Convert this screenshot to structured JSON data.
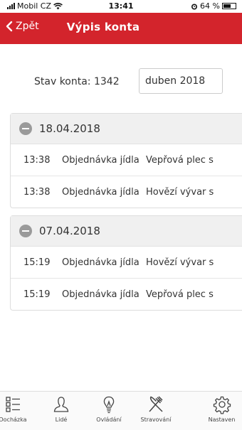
{
  "status_bar": {
    "carrier": "Mobil CZ",
    "time": "13:41",
    "battery": "64 %",
    "battery_level": 0.64
  },
  "header": {
    "back_label": "Zpět",
    "title": "Výpis konta"
  },
  "summary": {
    "balance": "Stav konta: 1342",
    "month": "duben 2018"
  },
  "groups": [
    {
      "date": "18.04.2018",
      "rows": [
        {
          "time": "13:38",
          "type": "Objednávka jídla",
          "meal": "Vepřová plec s"
        },
        {
          "time": "13:38",
          "type": "Objednávka jídla",
          "meal": "Hovězí vývar s"
        }
      ]
    },
    {
      "date": "07.04.2018",
      "rows": [
        {
          "time": "15:19",
          "type": "Objednávka jídla",
          "meal": "Hovězí vývar s"
        },
        {
          "time": "15:19",
          "type": "Objednávka jídla",
          "meal": "Vepřová plec s"
        }
      ]
    }
  ],
  "tabs": [
    {
      "label": "Docházka",
      "icon": "list-icon"
    },
    {
      "label": "Lidé",
      "icon": "person-icon"
    },
    {
      "label": "Ovládání",
      "icon": "lightbulb-icon"
    },
    {
      "label": "Stravování",
      "icon": "fork-knife-icon"
    },
    {
      "label": "Nastaven",
      "icon": "gear-icon"
    }
  ],
  "colors": {
    "accent": "#d3242c",
    "header_bg": "#f0f0f0"
  }
}
